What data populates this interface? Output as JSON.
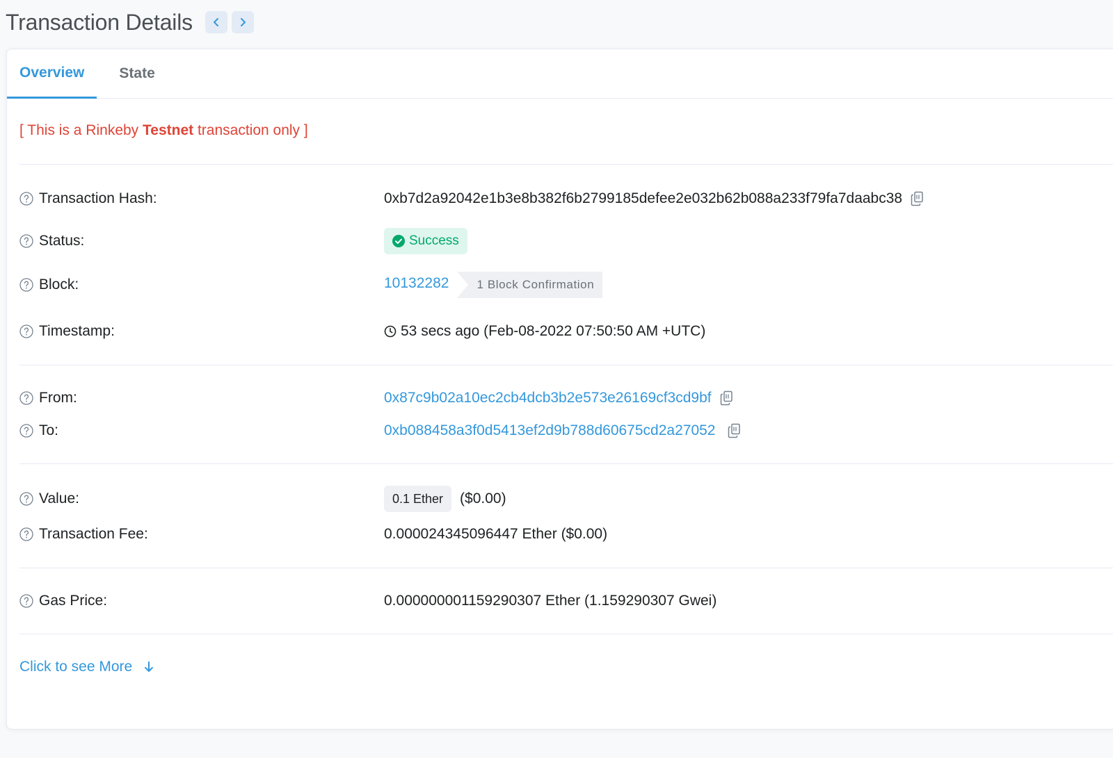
{
  "header": {
    "title": "Transaction Details"
  },
  "tabs": [
    {
      "label": "Overview",
      "active": true
    },
    {
      "label": "State",
      "active": false
    }
  ],
  "notice": {
    "prefix": "[ This is a Rinkeby ",
    "emphasis": "Testnet",
    "suffix": " transaction only ]"
  },
  "details": {
    "tx_hash": {
      "label": "Transaction Hash:",
      "value": "0xb7d2a92042e1b3e8b382f6b2799185defee2e032b62b088a233f79fa7daabc38"
    },
    "status": {
      "label": "Status:",
      "value": "Success"
    },
    "block": {
      "label": "Block:",
      "value": "10132282",
      "confirmations": "1 Block Confirmation"
    },
    "timestamp": {
      "label": "Timestamp:",
      "value": "53 secs ago (Feb-08-2022 07:50:50 AM +UTC)"
    },
    "from": {
      "label": "From:",
      "value": "0x87c9b02a10ec2cb4dcb3b2e573e26169cf3cd9bf"
    },
    "to": {
      "label": "To:",
      "value": "0xb088458a3f0d5413ef2d9b788d60675cd2a27052"
    },
    "value": {
      "label": "Value:",
      "amount": "0.1 Ether",
      "usd": "($0.00)"
    },
    "fee": {
      "label": "Transaction Fee:",
      "value": "0.000024345096447 Ether ($0.00)"
    },
    "gas_price": {
      "label": "Gas Price:",
      "value": "0.000000001159290307 Ether (1.159290307 Gwei)"
    }
  },
  "more": {
    "label": "Click to see More"
  },
  "colors": {
    "accent": "#3498db",
    "danger": "#de4437",
    "success": "#00a96b"
  }
}
